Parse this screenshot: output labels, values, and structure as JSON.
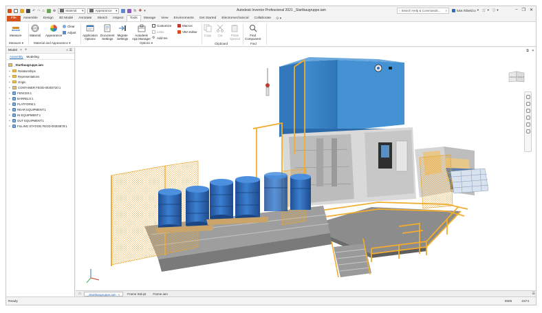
{
  "titlebar": {
    "app_title": "Autodesk Inventor Professional 2021   _Startbaugruppe.iam",
    "material_value": "Material",
    "appearance_value": "Appearance",
    "search_placeholder": "Search Help & Commands...",
    "user_name": "luke.rhibeld.io"
  },
  "ribbon_tabs": [
    {
      "label": "File"
    },
    {
      "label": "Assemble"
    },
    {
      "label": "Design"
    },
    {
      "label": "3D Model"
    },
    {
      "label": "Annotate"
    },
    {
      "label": "Sketch"
    },
    {
      "label": "Inspect"
    },
    {
      "label": "Tools"
    },
    {
      "label": "Manage"
    },
    {
      "label": "View"
    },
    {
      "label": "Environments"
    },
    {
      "label": "Get Started"
    },
    {
      "label": "Electromechanical"
    },
    {
      "label": "Collaborate"
    }
  ],
  "ribbon": {
    "measure": "Measure",
    "material": "Material",
    "appearance": "Appearance",
    "clear": "Clear",
    "adjust": "Adjust",
    "application_options_1": "Application",
    "application_options_2": "Options",
    "document_settings_1": "Document",
    "document_settings_2": "Settings",
    "migrate_settings_1": "Migrate",
    "migrate_settings_2": "Settings",
    "app_manager_1": "Autodesk",
    "app_manager_2": "App Manager",
    "customize": "Customize",
    "macros": "Macros",
    "links": "Links",
    "vba_editor": "VBA Editor",
    "add_ins": "Add-Ins",
    "copy": "Copy",
    "cut": "Cut",
    "paste_special_1": "Paste",
    "paste_special_2": "Special",
    "find_component_1": "Find",
    "find_component_2": "Component",
    "panels": {
      "measure": "Measure",
      "material_appearance": "Material and Appearance",
      "options": "Options",
      "clipboard": "Clipboard",
      "find": "Find"
    }
  },
  "browser": {
    "tab": "Model",
    "sub_tabs": [
      "Assembly",
      "Modeling"
    ],
    "root": "_Startbaugruppe.iam",
    "nodes": [
      {
        "label": "Relationships",
        "kind": "folder"
      },
      {
        "label": "Representations",
        "kind": "folder"
      },
      {
        "label": "Origin",
        "kind": "folder"
      },
      {
        "label": "CONTAINER FEOD-00303720:1",
        "kind": "asm"
      },
      {
        "label": "FENCES:1",
        "kind": "part"
      },
      {
        "label": "BARRELS:1",
        "kind": "part"
      },
      {
        "label": "PLATFORM:1",
        "kind": "part"
      },
      {
        "label": "REAR EQUIPMENT:1",
        "kind": "part"
      },
      {
        "label": "IN EQUIPMENT:1",
        "kind": "part"
      },
      {
        "label": "OUT EQUIPMENT:1",
        "kind": "part"
      },
      {
        "label": "FILLING STATION FEOD-00303879:1",
        "kind": "part"
      }
    ]
  },
  "viewcube": {
    "left_face": "FRONT",
    "right_face": "RIGHT"
  },
  "doc_tabs": [
    "_Startbaugruppe.iam",
    "Frame Std.ipt",
    "Frame.iam"
  ],
  "status": {
    "text": "Ready",
    "count_a": "3565",
    "count_b": "1574"
  },
  "colors": {
    "file_tab": "#d8511d",
    "machine_blue": "#3c86c4",
    "rail_orange": "#f1ad2e",
    "barrel_blue": "#2c68b6"
  }
}
